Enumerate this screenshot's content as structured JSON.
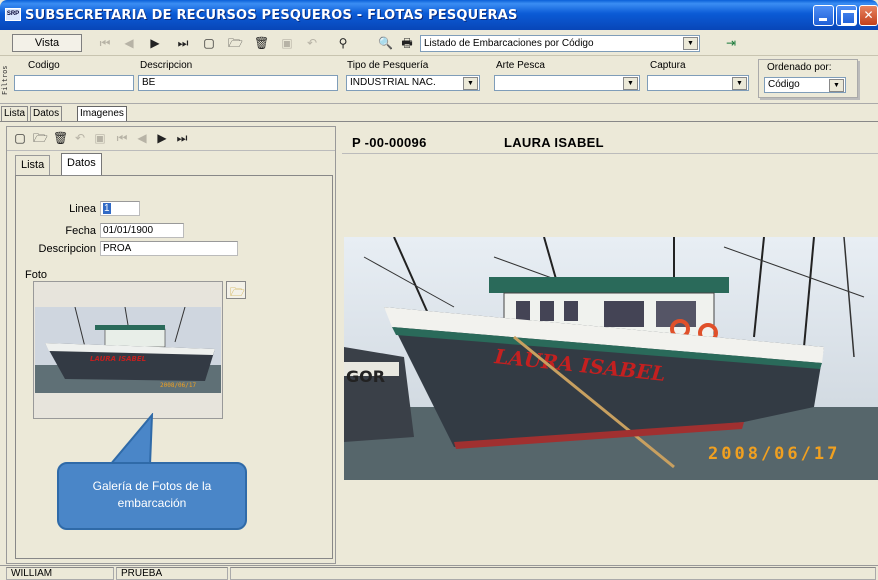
{
  "window": {
    "app_icon": "SRP",
    "title": "SUBSECRETARIA DE RECURSOS PESQUEROS - FLOTAS PESQUERAS"
  },
  "toolbar": {
    "vista_label": "Vista",
    "report_selected": "Listado de Embarcaciones por  Código"
  },
  "filters": {
    "side_label": "Filtros",
    "codigo": {
      "label": "Codigo",
      "value": ""
    },
    "descripcion": {
      "label": "Descripcion",
      "value": "BE"
    },
    "tipo_pesqueria": {
      "label": "Tipo de Pesquería",
      "value": "INDUSTRIAL NAC."
    },
    "arte_pesca": {
      "label": "Arte Pesca",
      "value": ""
    },
    "captura": {
      "label": "Captura",
      "value": ""
    },
    "ordenado_por": {
      "label": "Ordenado por:",
      "value": "Código"
    }
  },
  "main_tabs": [
    "Lista",
    "Datos",
    "Imagenes"
  ],
  "sub_tabs": [
    "Lista",
    "Datos"
  ],
  "form": {
    "linea_label": "Linea",
    "linea_value": "1",
    "fecha_label": "Fecha",
    "fecha_value": "01/01/1900",
    "descripcion_label": "Descripcion",
    "descripcion_value": "PROA",
    "foto_label": "Foto"
  },
  "photo": {
    "boat_name": "LAURA ISABEL",
    "date_stamp": "2008/06/17",
    "other_boat": "GOR"
  },
  "callout": {
    "text": "Galería de Fotos de la embarcación"
  },
  "record": {
    "code": "P -00-00096",
    "name": "LAURA ISABEL"
  },
  "status": {
    "user": "WILLIAM",
    "environment": "PRUEBA"
  },
  "icons": {
    "first": "first-record-icon",
    "prev": "previous-record-icon",
    "next": "next-record-icon",
    "last": "last-record-icon",
    "new": "new-document-icon",
    "open": "open-folder-icon",
    "delete": "trash-icon",
    "save": "save-icon",
    "undo": "undo-icon",
    "search": "binoculars-icon",
    "preview": "print-preview-icon",
    "print": "printer-icon",
    "exit": "exit-icon"
  },
  "colors": {
    "title_bar": "#0b5bd6",
    "callout": "#4a86c8",
    "date_stamp": "#f0a020"
  }
}
